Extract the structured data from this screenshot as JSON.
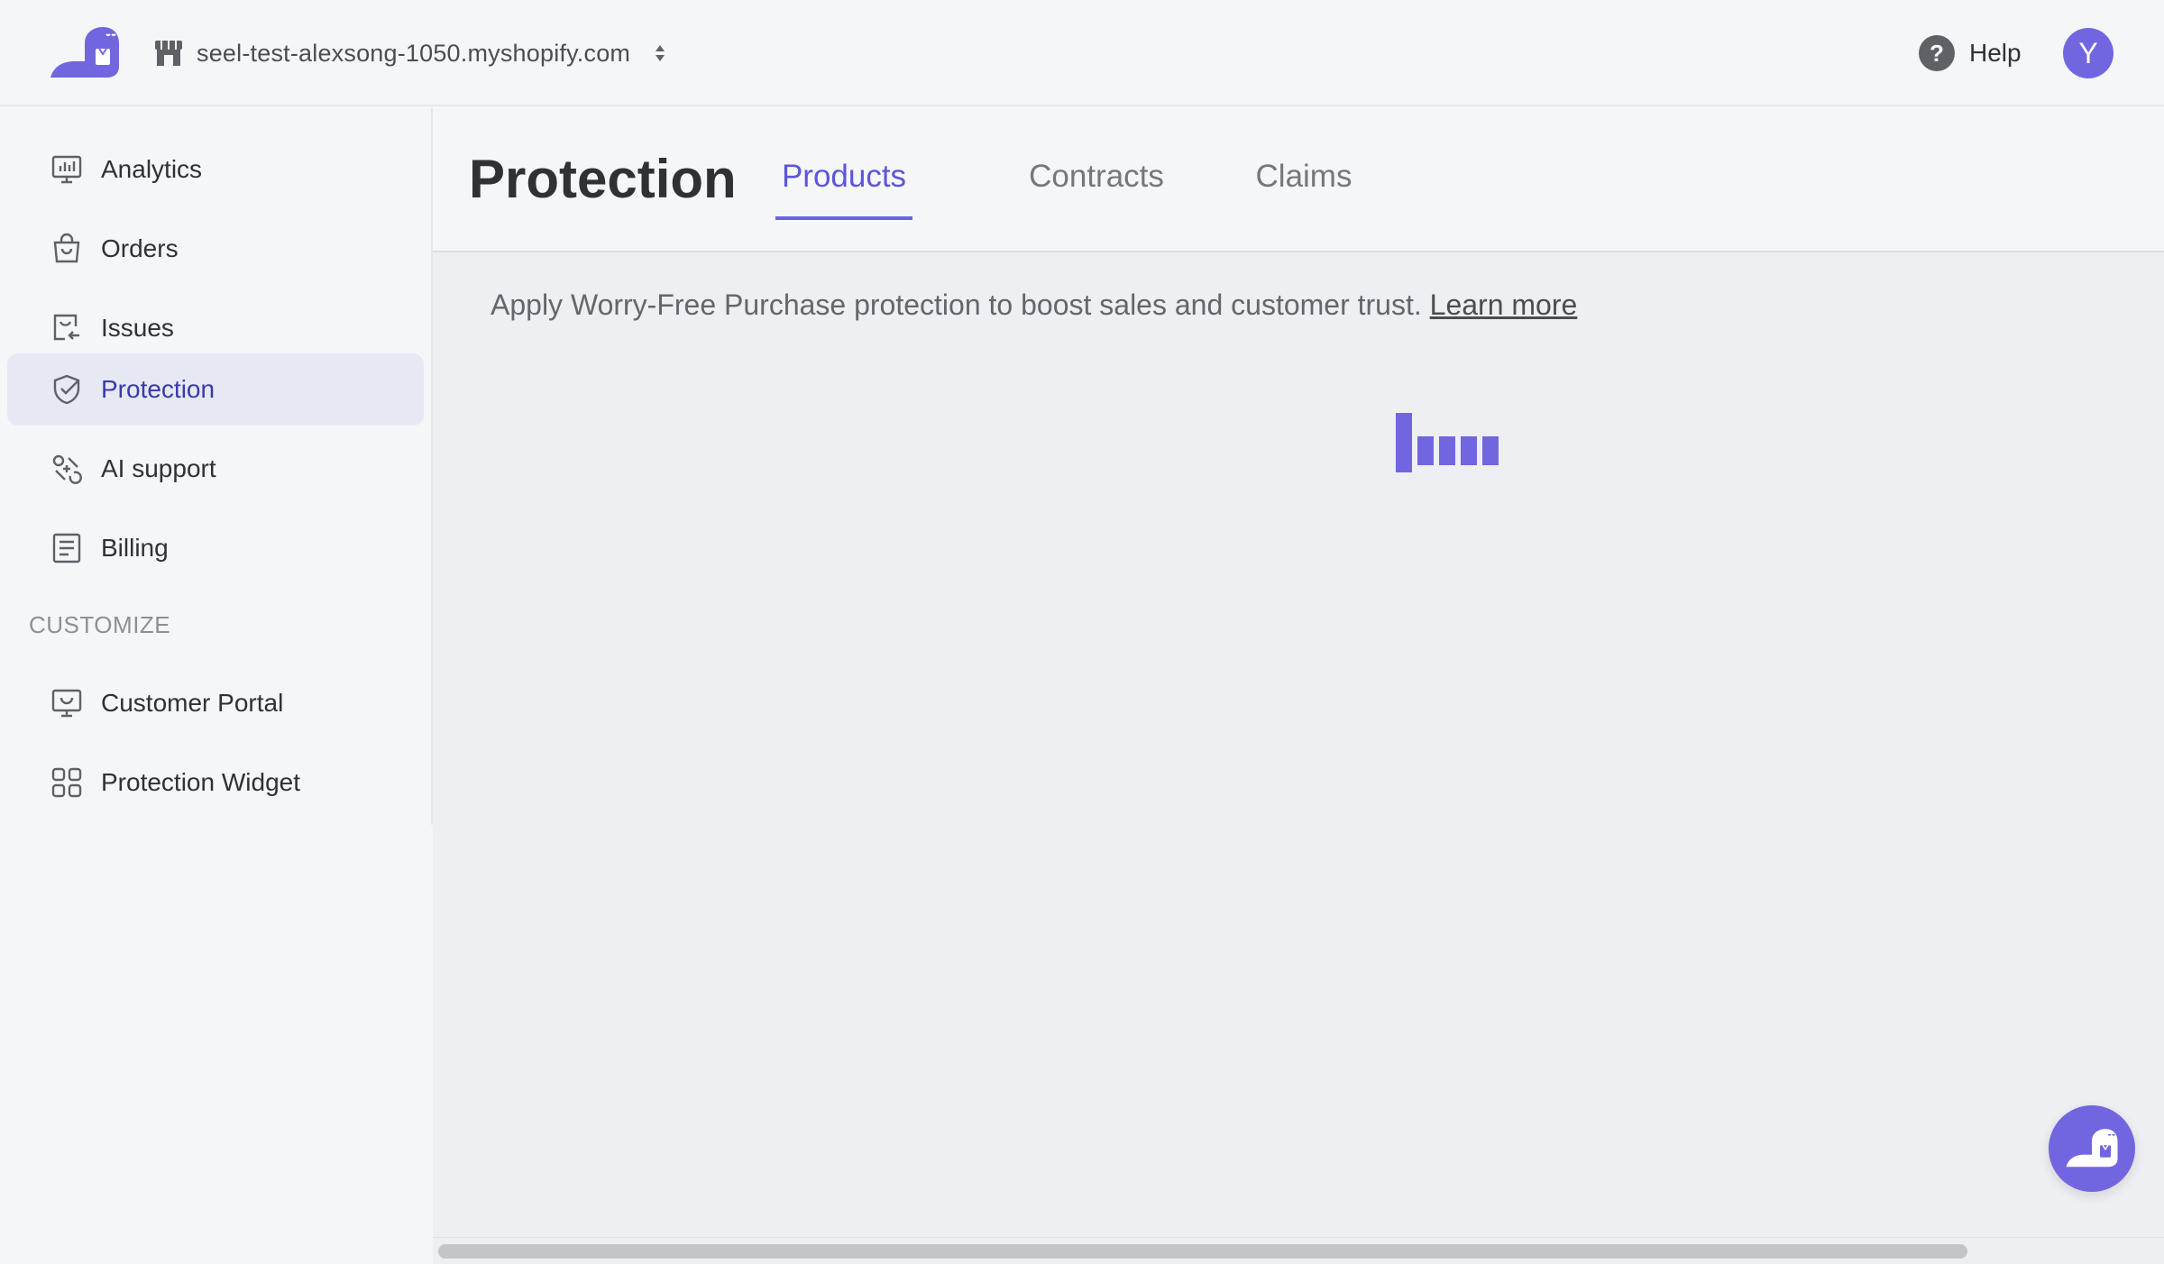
{
  "header": {
    "store_name": "seel-test-alexsong-1050.myshopify.com",
    "help_label": "Help",
    "avatar_initial": "Y"
  },
  "sidebar": {
    "items": [
      {
        "label": "Analytics",
        "icon": "analytics-icon"
      },
      {
        "label": "Orders",
        "icon": "shopping-bag-icon"
      },
      {
        "label": "Issues",
        "icon": "issues-icon"
      },
      {
        "label": "Protection",
        "icon": "shield-check-icon",
        "active": true
      },
      {
        "label": "AI support",
        "icon": "ai-support-icon"
      },
      {
        "label": "Billing",
        "icon": "billing-icon"
      }
    ],
    "section_label": "CUSTOMIZE",
    "customize_items": [
      {
        "label": "Customer Portal",
        "icon": "monitor-icon"
      },
      {
        "label": "Protection Widget",
        "icon": "grid-icon"
      }
    ]
  },
  "main": {
    "page_title": "Protection",
    "tabs": [
      {
        "label": "Products",
        "active": true
      },
      {
        "label": "Contracts"
      },
      {
        "label": "Claims"
      }
    ],
    "info_text": "Apply Worry-Free Purchase protection to boost sales and customer trust.",
    "learn_more": "Learn more"
  },
  "colors": {
    "accent": "#7266e0",
    "active_nav_bg": "#e6e8f4",
    "active_nav_text": "#3a3aa8"
  }
}
